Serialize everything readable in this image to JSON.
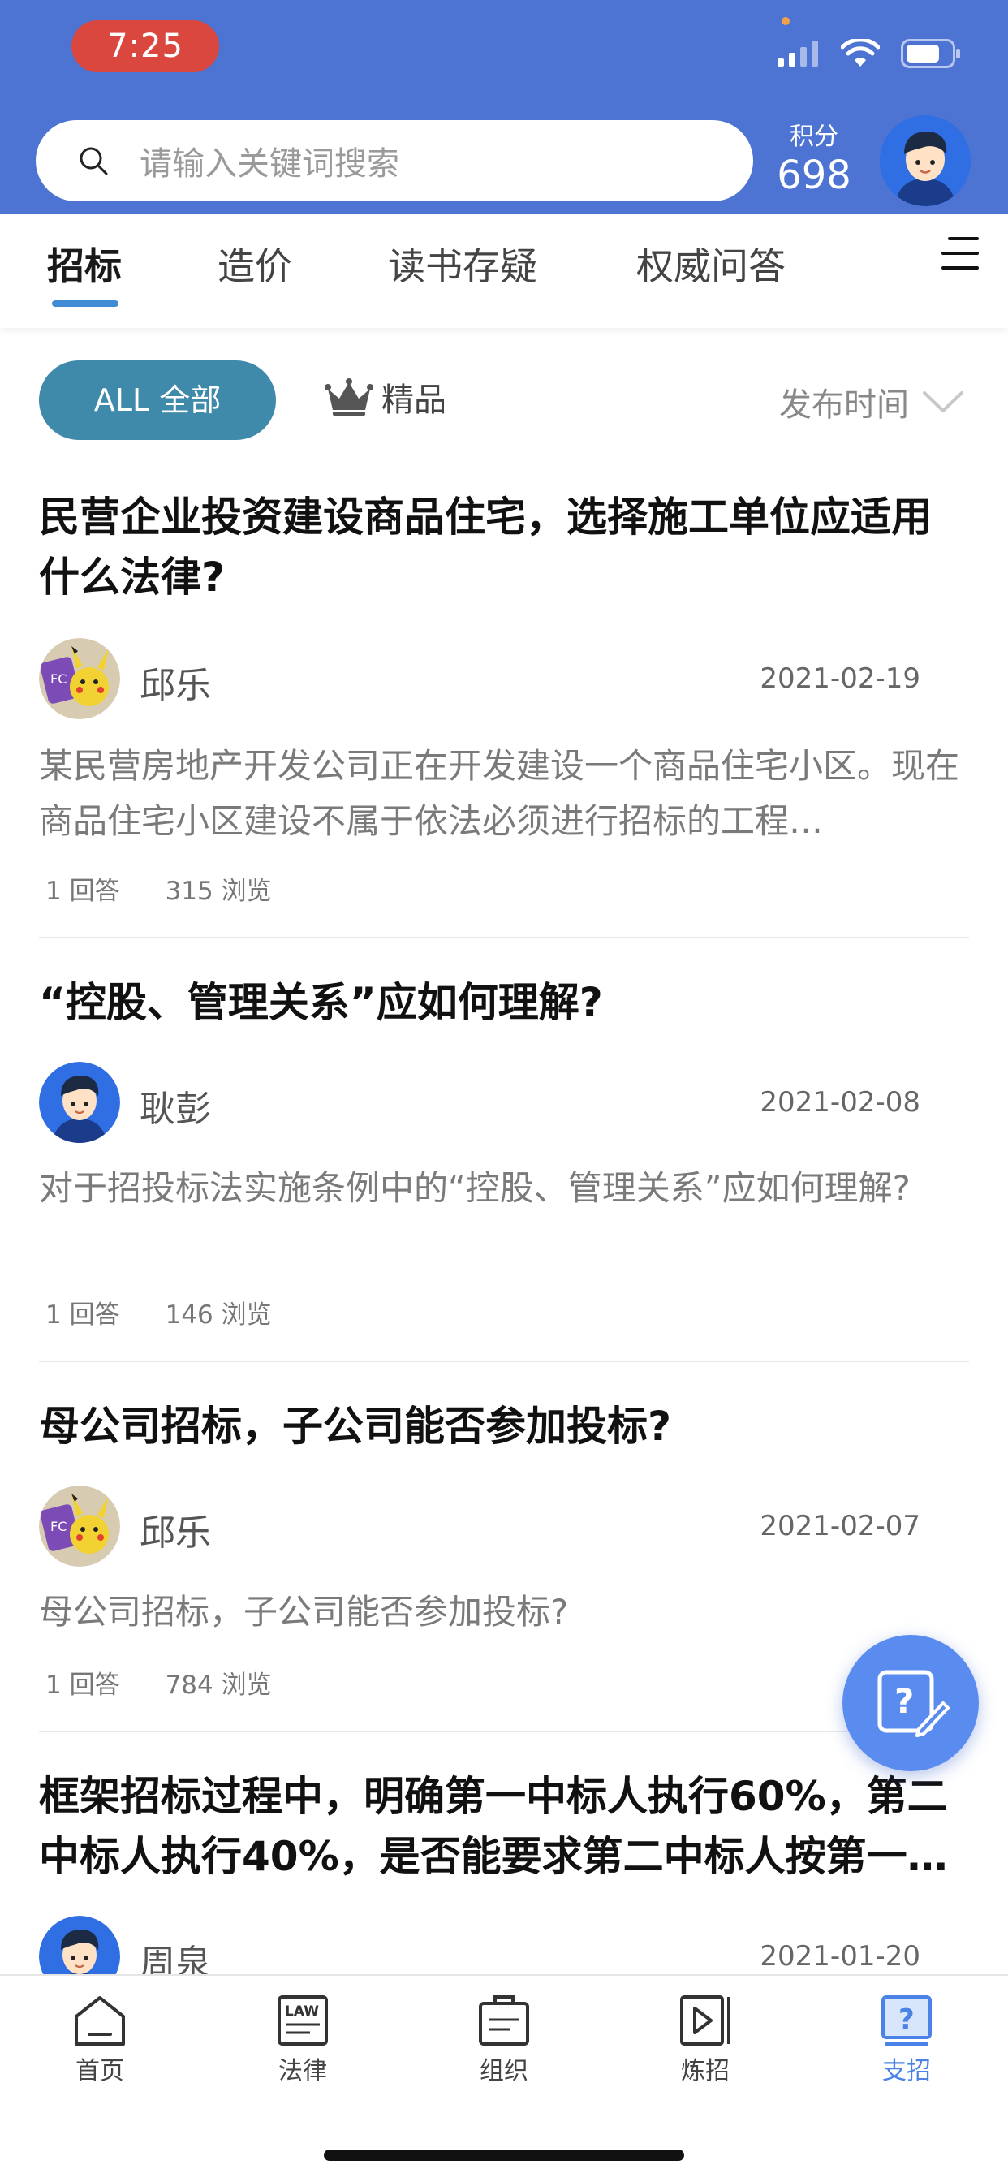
{
  "status_bar": {
    "time": "7:25"
  },
  "search": {
    "placeholder": "请输入关键词搜索"
  },
  "points": {
    "label": "积分",
    "value": "698"
  },
  "tabs": [
    {
      "label": "招标",
      "active": true
    },
    {
      "label": "造价",
      "active": false
    },
    {
      "label": "读书存疑",
      "active": false
    },
    {
      "label": "权威问答",
      "active": false
    }
  ],
  "filters": {
    "all_label": "ALL 全部",
    "premium_label": "精品",
    "sort_label": "发布时间"
  },
  "items": [
    {
      "title": "民营企业投资建设商品住宅，选择施工单位应适用什么法律?",
      "author": "邱乐",
      "avatar": "pikachu-avatar",
      "date": "2021-02-19",
      "body": "某民营房地产开发公司正在开发建设一个商品住宅小区。现在商品住宅小区建设不属于依法必须进行招标的工程…",
      "answers": "1 回答",
      "views": "315 浏览"
    },
    {
      "title": "“控股、管理关系”应如何理解?",
      "author": "耿彭",
      "avatar": "default-user-avatar",
      "date": "2021-02-08",
      "body": "对于招投标法实施条例中的“控股、管理关系”应如何理解?",
      "answers": "1 回答",
      "views": "146 浏览"
    },
    {
      "title": "母公司招标，子公司能否参加投标?",
      "author": "邱乐",
      "avatar": "pikachu-avatar",
      "date": "2021-02-07",
      "body": "母公司招标，子公司能否参加投标?",
      "answers": "1 回答",
      "views": "784 浏览"
    },
    {
      "title": "框架招标过程中，明确第一中标人执行60%，第二中标人执行40%，是否能要求第二中标人按第一…",
      "author": "周泉",
      "avatar": "default-user-avatar",
      "date": "2021-01-20"
    }
  ],
  "bottom_nav": [
    {
      "label": "首页",
      "icon": "home-icon",
      "active": false
    },
    {
      "label": "法律",
      "icon": "law-icon",
      "active": false
    },
    {
      "label": "组织",
      "icon": "organization-icon",
      "active": false
    },
    {
      "label": "炼招",
      "icon": "video-icon",
      "active": false
    },
    {
      "label": "支招",
      "icon": "question-icon",
      "active": true
    }
  ],
  "colors": {
    "header_blue": "#4e74d3",
    "time_pill_red": "#d9473e",
    "filter_teal": "#3f8aaa",
    "active_blue": "#4a82e6"
  }
}
